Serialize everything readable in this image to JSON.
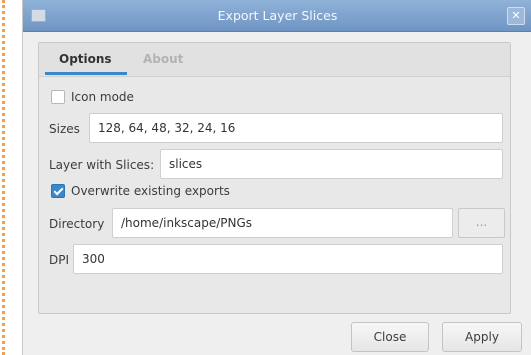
{
  "window": {
    "title": "Export Layer Slices",
    "close_glyph": "✕"
  },
  "tabs": [
    {
      "label": "Options",
      "active": true
    },
    {
      "label": "About",
      "active": false
    }
  ],
  "options": {
    "icon_mode": {
      "label": "Icon mode",
      "checked": false
    },
    "sizes": {
      "label": "Sizes",
      "value": "128, 64, 48, 32, 24, 16"
    },
    "layer_with_slices": {
      "label": "Layer with Slices:",
      "value": "slices"
    },
    "overwrite": {
      "label": "Overwrite existing exports",
      "checked": true
    },
    "directory": {
      "label": "Directory",
      "value": "/home/inkscape/PNGs",
      "browse_label": "..."
    },
    "dpi": {
      "label": "DPI",
      "value": "300"
    }
  },
  "buttons": {
    "close": "Close",
    "apply": "Apply"
  },
  "colors": {
    "titlebar": "#7fa4cf",
    "accent": "#3a88c9"
  },
  "icons": {
    "window": "window-menu-icon",
    "close": "close-icon"
  }
}
